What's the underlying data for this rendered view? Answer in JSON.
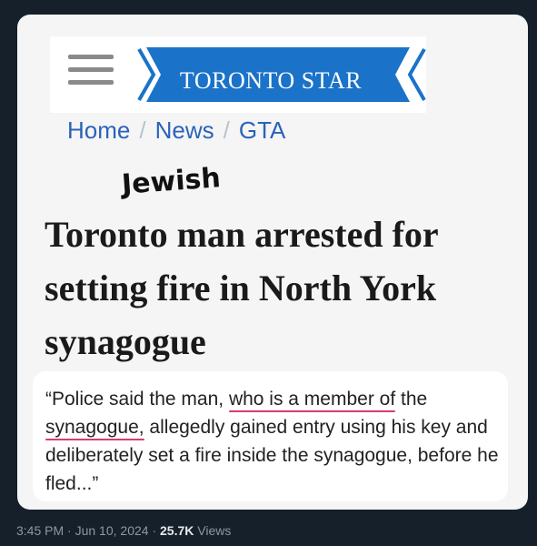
{
  "header": {
    "logo_text": "TORONTO STAR"
  },
  "breadcrumb": {
    "items": [
      "Home",
      "News",
      "GTA"
    ],
    "separator": "/"
  },
  "annotation": "Jewish",
  "headline": {
    "line1": "Toronto man arrested for",
    "line2": "setting fire in North York",
    "line3": "synagogue"
  },
  "quote": {
    "part1": "“Police said the man, ",
    "underline1": "who is a member of",
    "part2": " the",
    "underline2": "synagogue,",
    "part3": " allegedly gained entry using his key and deliberately set a fire inside the synagogue, before he fled...”"
  },
  "post_meta": {
    "time": "3:45 PM",
    "dot1": " · ",
    "date": "Jun 10, 2024",
    "dot2": " · ",
    "views_count": "25.7K",
    "views_label": " Views"
  },
  "colors": {
    "logo_blue": "#1a73c8",
    "link_blue": "#2b63b8",
    "underline_pink": "#d63c6f"
  }
}
